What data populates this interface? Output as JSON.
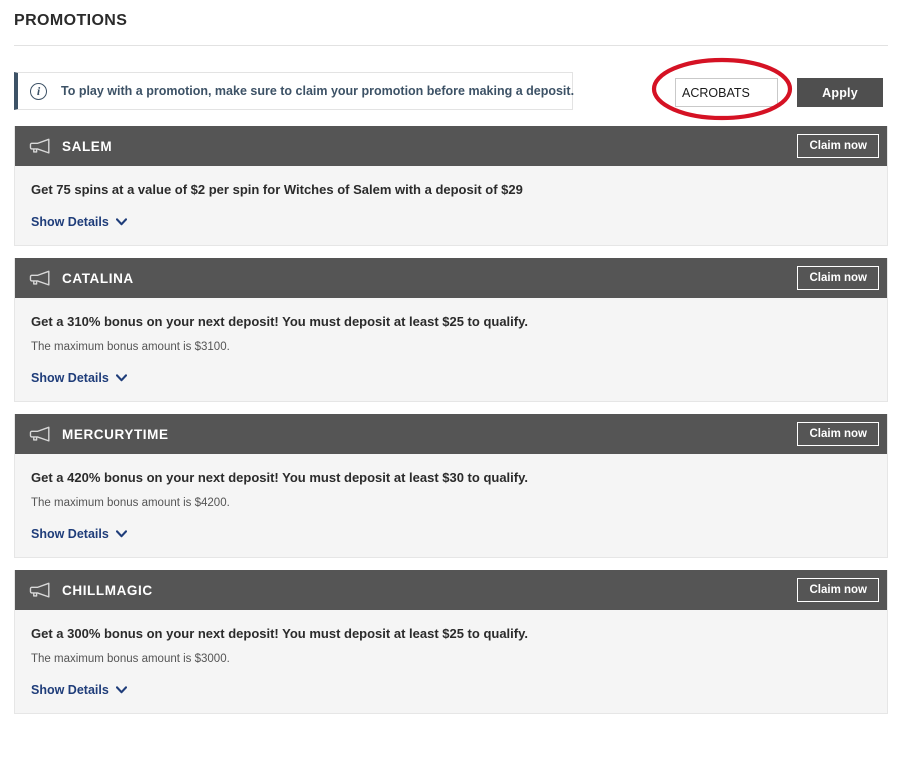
{
  "page": {
    "title": "PROMOTIONS"
  },
  "info_banner": {
    "icon": "info-circle-icon",
    "text": "To play with a promotion, make sure to claim your promotion before making a deposit.",
    "accent_color": "#3d5266"
  },
  "promo_entry": {
    "input_value": "ACROBATS",
    "input_placeholder": "Promo code",
    "apply_label": "Apply",
    "apply_bg": "#4f4f4f"
  },
  "annotation": {
    "shape": "ellipse",
    "color": "#d51224",
    "target": "promo-code-input"
  },
  "cards": [
    {
      "code": "SALEM",
      "icon": "megaphone-icon",
      "claim_label": "Claim now",
      "headline": "Get 75 spins at a value of $2 per spin for Witches of Salem with a deposit of $29",
      "subline": "",
      "details_label": "Show Details"
    },
    {
      "code": "CATALINA",
      "icon": "megaphone-icon",
      "claim_label": "Claim now",
      "headline": "Get a 310% bonus on your next deposit! You must deposit at least $25 to qualify.",
      "subline": "The maximum bonus amount is $3100.",
      "details_label": "Show Details"
    },
    {
      "code": "MERCURYTIME",
      "icon": "megaphone-icon",
      "claim_label": "Claim now",
      "headline": "Get a 420% bonus on your next deposit! You must deposit at least $30 to qualify.",
      "subline": "The maximum bonus amount is $4200.",
      "details_label": "Show Details"
    },
    {
      "code": "CHILLMAGIC",
      "icon": "megaphone-icon",
      "claim_label": "Claim now",
      "headline": "Get a 300% bonus on your next deposit! You must deposit at least $25 to qualify.",
      "subline": "The maximum bonus amount is $3000.",
      "details_label": "Show Details"
    }
  ],
  "colors": {
    "header_bg": "#555555",
    "card_body_bg": "#f5f5f5",
    "link": "#1f3d7a",
    "annotation_red": "#d51224"
  }
}
